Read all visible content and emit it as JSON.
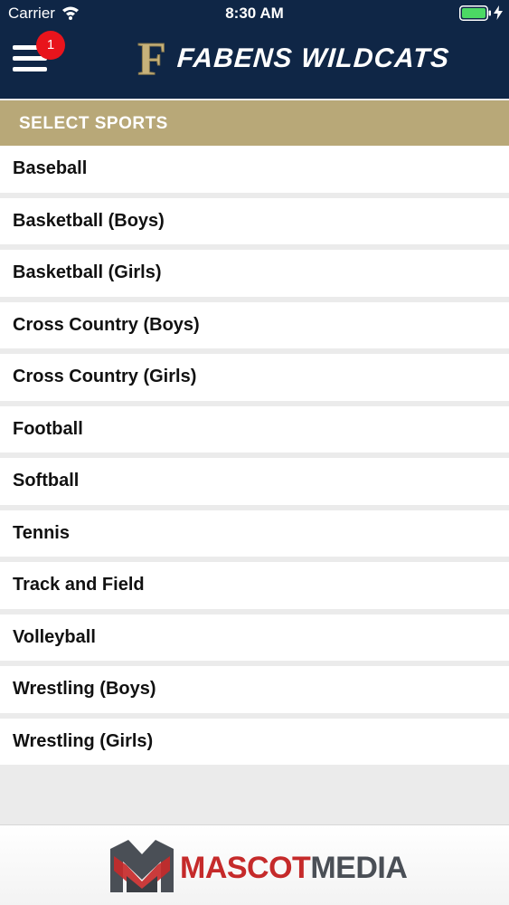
{
  "status_bar": {
    "carrier": "Carrier",
    "time": "8:30 AM",
    "icons": [
      "wifi-icon",
      "battery-icon",
      "charging-bolt-icon"
    ]
  },
  "nav": {
    "title": "FABENS WILDCATS",
    "logo_letter": "F",
    "menu_icon": "hamburger-menu-icon",
    "notification_count": "1"
  },
  "section": {
    "title": "SELECT SPORTS"
  },
  "sports": [
    "Baseball",
    "Basketball (Boys)",
    "Basketball (Girls)",
    "Cross Country (Boys)",
    "Cross Country (Girls)",
    "Football",
    "Softball",
    "Tennis",
    "Track and Field",
    "Volleyball",
    "Wrestling (Boys)",
    "Wrestling (Girls)"
  ],
  "footer": {
    "brand_part1": "MASCOT",
    "brand_part2": "MEDIA"
  },
  "colors": {
    "header_bg": "#0f2646",
    "section_bg": "#b8a878",
    "badge": "#e8141c",
    "logo_gold": "#c7b27a",
    "brand_red": "#c52a2a",
    "brand_gray": "#4a4f56"
  }
}
